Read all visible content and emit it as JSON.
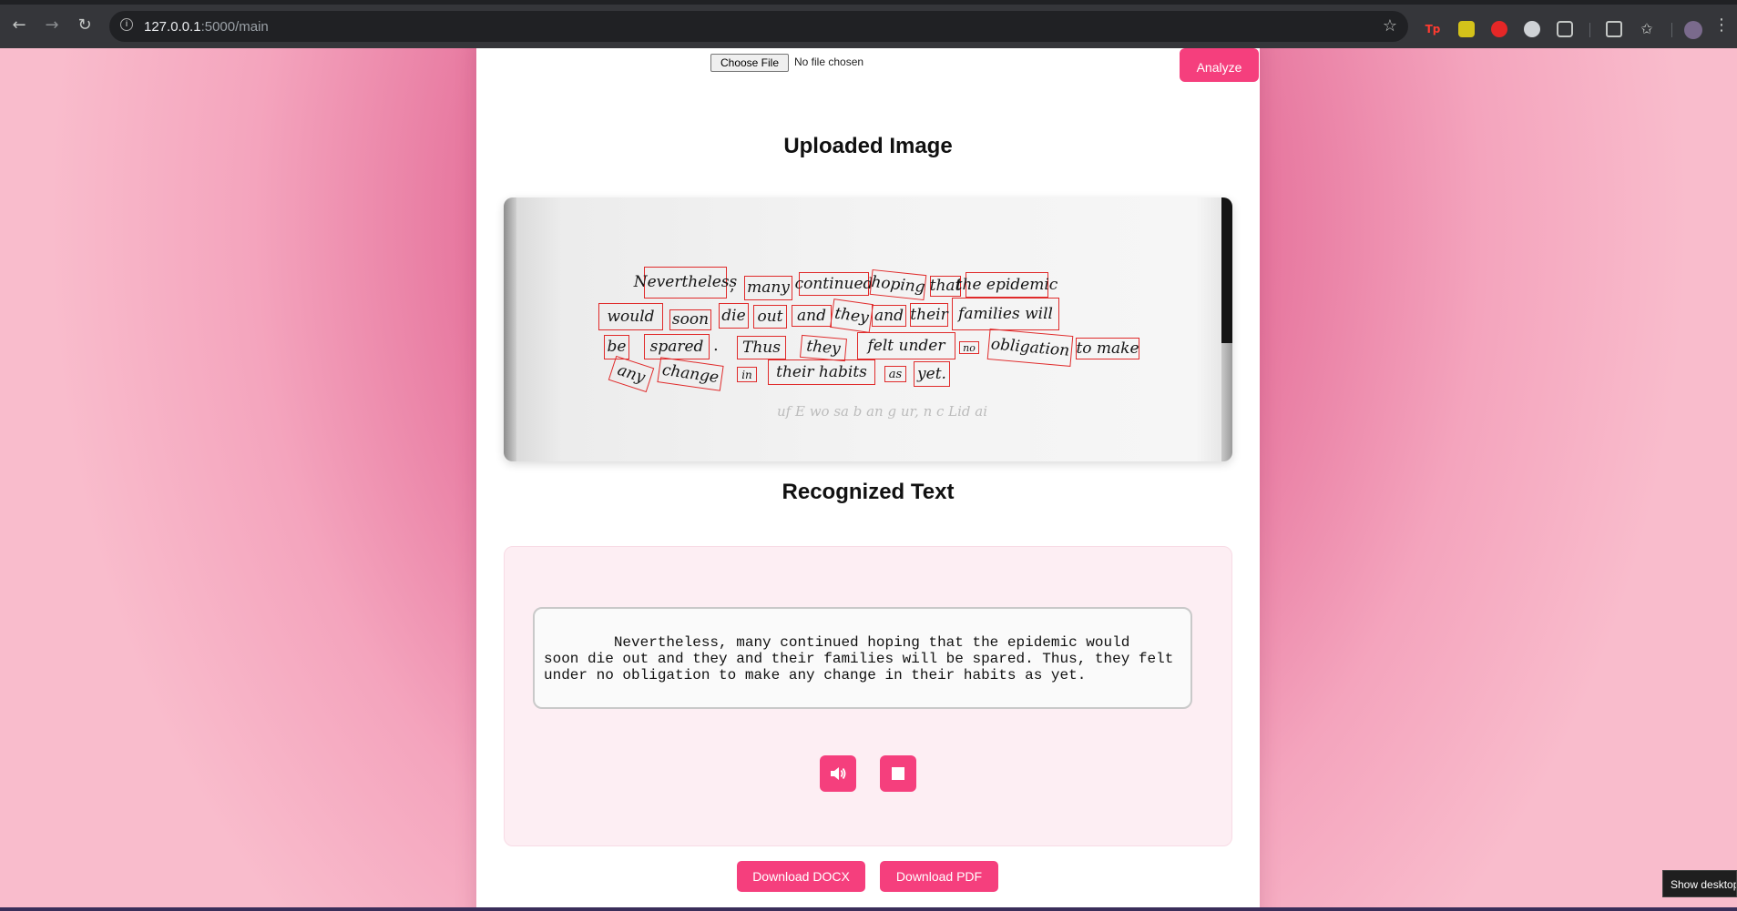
{
  "browser": {
    "url_scheme_host": "127.0.0.1",
    "url_rest": ":5000/main",
    "nav": {
      "back": "←",
      "forward": "→",
      "reload": "↻"
    },
    "icons": {
      "info": "i",
      "bookmark_star": "☆",
      "ext_tp": "Tp",
      "ext_extensions": "puzzle",
      "profile": "avatar"
    },
    "menu": "⋮"
  },
  "upload": {
    "choose_file_label": "Choose File",
    "no_file_text": "No file chosen",
    "analyze_label": "Analyze"
  },
  "uploaded_image": {
    "title": "Uploaded Image",
    "words": [
      "Nevertheless",
      "many",
      "continued",
      "hoping",
      "that",
      "the epidemic",
      "would",
      "soon",
      "die",
      "out",
      "and",
      "they",
      "and",
      "their",
      "families will",
      "be",
      "spared",
      "Thus",
      "they",
      "felt under",
      "no",
      "obligation",
      "to make",
      "any",
      "change",
      "in",
      "their habits",
      "as",
      "yet."
    ],
    "punctuation": {
      "comma": ",",
      "period": "."
    },
    "faint_text": "uf E wo sa b an g ur, n c Lid ai"
  },
  "recognized": {
    "title": "Recognized Text",
    "text": "        Nevertheless, many continued hoping that the epidemic would\nsoon die out and they and their families will be spared. Thus, they felt\nunder no obligation to make any change in their habits as yet."
  },
  "downloads": {
    "docx_label": "Download DOCX",
    "pdf_label": "Download PDF"
  },
  "taskbar": {
    "tooltip": "Show desktop"
  },
  "colors": {
    "accent": "#f53f7d",
    "background_pink": "#e5719b",
    "box_red": "#e02b2b"
  }
}
